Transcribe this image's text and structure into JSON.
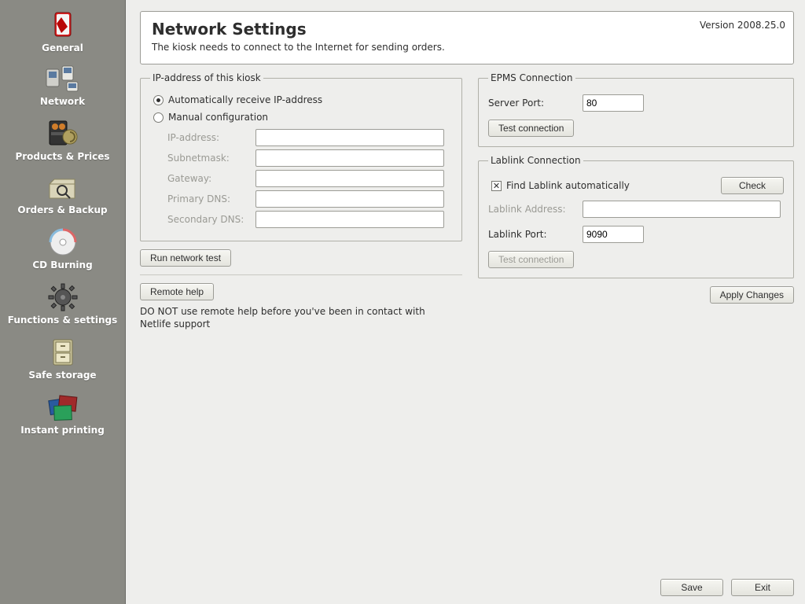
{
  "sidebar": {
    "items": [
      {
        "label": "General"
      },
      {
        "label": "Network"
      },
      {
        "label": "Products & Prices"
      },
      {
        "label": "Orders & Backup"
      },
      {
        "label": "CD Burning"
      },
      {
        "label": "Functions & settings"
      },
      {
        "label": "Safe storage"
      },
      {
        "label": "Instant printing"
      }
    ]
  },
  "header": {
    "title": "Network Settings",
    "version": "Version 2008.25.0",
    "subtitle": "The kiosk needs to connect to the Internet for sending orders."
  },
  "ip": {
    "legend": "IP-address of this kiosk",
    "auto_label": "Automatically receive IP-address",
    "manual_label": "Manual configuration",
    "fields": {
      "ip": "IP-address:",
      "mask": "Subnetmask:",
      "gw": "Gateway:",
      "dns1": "Primary DNS:",
      "dns2": "Secondary DNS:"
    },
    "values": {
      "ip": "",
      "mask": "",
      "gw": "",
      "dns1": "",
      "dns2": ""
    }
  },
  "run_test_btn": "Run network test",
  "remote_help_btn": "Remote help",
  "remote_help_note": "DO NOT use remote help before you've been in contact with Netlife support",
  "epms": {
    "legend": "EPMS Connection",
    "port_label": "Server Port:",
    "port_value": "80",
    "test_btn": "Test connection"
  },
  "lablink": {
    "legend": "Lablink Connection",
    "auto_label": "Find Lablink automatically",
    "check_btn": "Check",
    "addr_label": "Lablink Address:",
    "addr_value": "",
    "port_label": "Lablink Port:",
    "port_value": "9090",
    "test_btn": "Test connection"
  },
  "apply_btn": "Apply Changes",
  "footer": {
    "save": "Save",
    "exit": "Exit"
  }
}
